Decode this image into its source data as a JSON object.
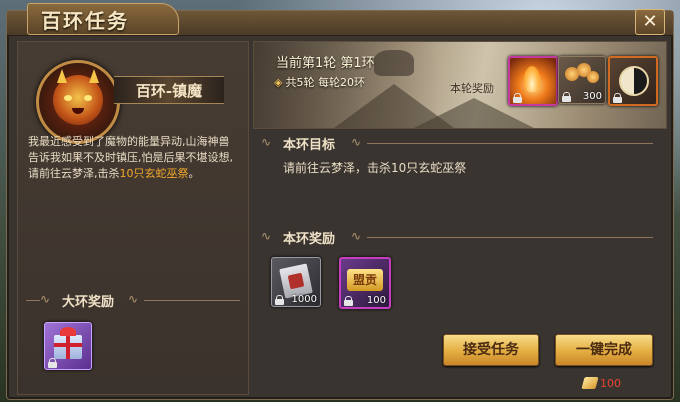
{
  "window": {
    "title": "百环任务",
    "close_icon": "✕"
  },
  "boss": {
    "name": "百环-镇魔",
    "icon": "demon-mask-icon"
  },
  "story": {
    "text_before": "我最近感受到了魔物的能量异动,山海神兽告诉我如果不及时镇压,怕是后果不堪设想,请前往云梦泽,击杀",
    "highlight": "10只玄蛇巫祭",
    "text_after": "。"
  },
  "big_reward": {
    "label": "大环奖励",
    "items": [
      {
        "icon": "gift-box-icon",
        "locked": true
      }
    ]
  },
  "round": {
    "current": "当前第1轮 第1环",
    "total": "共5轮 每轮20环",
    "reward_label": "本轮奖励",
    "items": [
      {
        "icon": "flame-icon",
        "locked": true,
        "count": ""
      },
      {
        "icon": "coins-icon",
        "locked": true,
        "count": "300"
      },
      {
        "icon": "bagua-icon",
        "locked": true,
        "count": ""
      }
    ]
  },
  "goal": {
    "label": "本环目标",
    "text": "请前往云梦泽，击杀10只玄蛇巫祭"
  },
  "ring_reward": {
    "label": "本环奖励",
    "items": [
      {
        "icon": "scroll-icon",
        "locked": true,
        "count": "1000"
      },
      {
        "icon": "guild-token-icon",
        "icon_text": "盟贡",
        "locked": true,
        "count": "100"
      }
    ]
  },
  "buttons": {
    "accept": "接受任务",
    "complete": "一键完成"
  },
  "cost": {
    "icon": "ingot-icon",
    "value": "100"
  },
  "colors": {
    "accent": "#e4ad41",
    "highlight": "#f2a72b",
    "cost": "#e8442e"
  }
}
